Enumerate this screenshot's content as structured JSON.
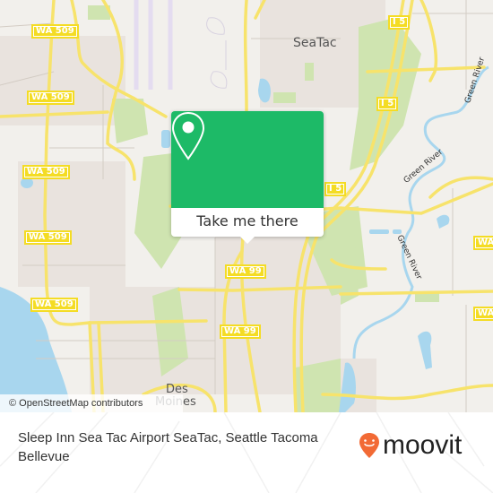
{
  "map": {
    "place_labels": [
      {
        "id": "seatac",
        "text": "SeaTac"
      },
      {
        "id": "des-moines-line1",
        "text": "Des"
      },
      {
        "id": "des-moines-line2",
        "text": "Moines"
      }
    ],
    "road_shields": [
      {
        "text": "WA 509"
      },
      {
        "text": "WA 509"
      },
      {
        "text": "WA 509"
      },
      {
        "text": "WA 509"
      },
      {
        "text": "WA 509"
      },
      {
        "text": "WA 99"
      },
      {
        "text": "WA 99"
      },
      {
        "text": "I 5"
      },
      {
        "text": "I 5"
      },
      {
        "text": "I 5"
      },
      {
        "text": "WA"
      },
      {
        "text": "WA"
      }
    ],
    "river_labels": [
      {
        "text": "Green River"
      },
      {
        "text": "Green River"
      },
      {
        "text": "Green River"
      }
    ],
    "attribution": "© OpenStreetMap contributors",
    "colors": {
      "land": "#f2f0ec",
      "urban": "#e8e2dd",
      "park": "#cfe4b0",
      "water": "#a8d6ee",
      "road": "#f7e36b",
      "shield": "#f4dc24",
      "runway": "#e4dcf0"
    }
  },
  "popup": {
    "icon": "map-pin-icon",
    "button_label": "Take me there",
    "color": "#1dba67"
  },
  "footer": {
    "title": "Sleep Inn Sea Tac Airport SeaTac, Seattle Tacoma Bellevue",
    "logo_text": "moovit",
    "logo_icon": "moovit-pin-icon",
    "logo_color": "#f26a35"
  }
}
